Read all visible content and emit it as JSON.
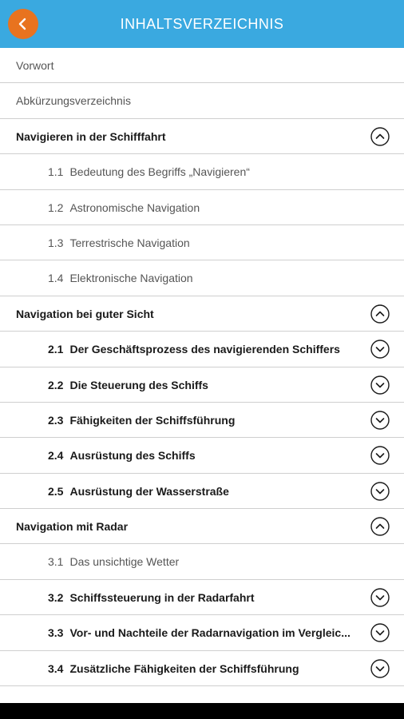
{
  "header": {
    "title": "INHALTSVERZEICHNIS"
  },
  "rows": [
    {
      "label": "Vorwort"
    },
    {
      "label": "Abkürzungsverzeichnis"
    },
    {
      "label": "Navigieren in der Schifffahrt",
      "toggle": "chevron-up-icon"
    },
    {
      "num": "1.1",
      "label": "Bedeutung des Begriffs „Navigieren“"
    },
    {
      "num": "1.2",
      "label": "Astronomische Navigation"
    },
    {
      "num": "1.3",
      "label": "Terrestrische Navigation"
    },
    {
      "num": "1.4",
      "label": "Elektronische Navigation"
    },
    {
      "label": "Navigation bei guter Sicht",
      "toggle": "chevron-up-icon"
    },
    {
      "num": "2.1",
      "label": "Der Geschäftsprozess des navigierenden Schiffers",
      "toggle": "chevron-down-icon"
    },
    {
      "num": "2.2",
      "label": "Die Steuerung des Schiffs",
      "toggle": "chevron-down-icon"
    },
    {
      "num": "2.3",
      "label": "Fähigkeiten der Schiffsführung",
      "toggle": "chevron-down-icon"
    },
    {
      "num": "2.4",
      "label": "Ausrüstung des Schiffs",
      "toggle": "chevron-down-icon"
    },
    {
      "num": "2.5",
      "label": "Ausrüstung der Wasserstraße",
      "toggle": "chevron-down-icon"
    },
    {
      "label": "Navigation mit Radar",
      "toggle": "chevron-up-icon"
    },
    {
      "num": "3.1",
      "label": "Das unsichtige Wetter"
    },
    {
      "num": "3.2",
      "label": "Schiffssteuerung in der Radarfahrt",
      "toggle": "chevron-down-icon"
    },
    {
      "num": "3.3",
      "label": "Vor- und Nachteile der Radarnavigation im Vergleic...",
      "toggle": "chevron-down-icon"
    },
    {
      "num": "3.4",
      "label": "Zusätzliche Fähigkeiten der Schiffsführung",
      "toggle": "chevron-down-icon"
    }
  ]
}
